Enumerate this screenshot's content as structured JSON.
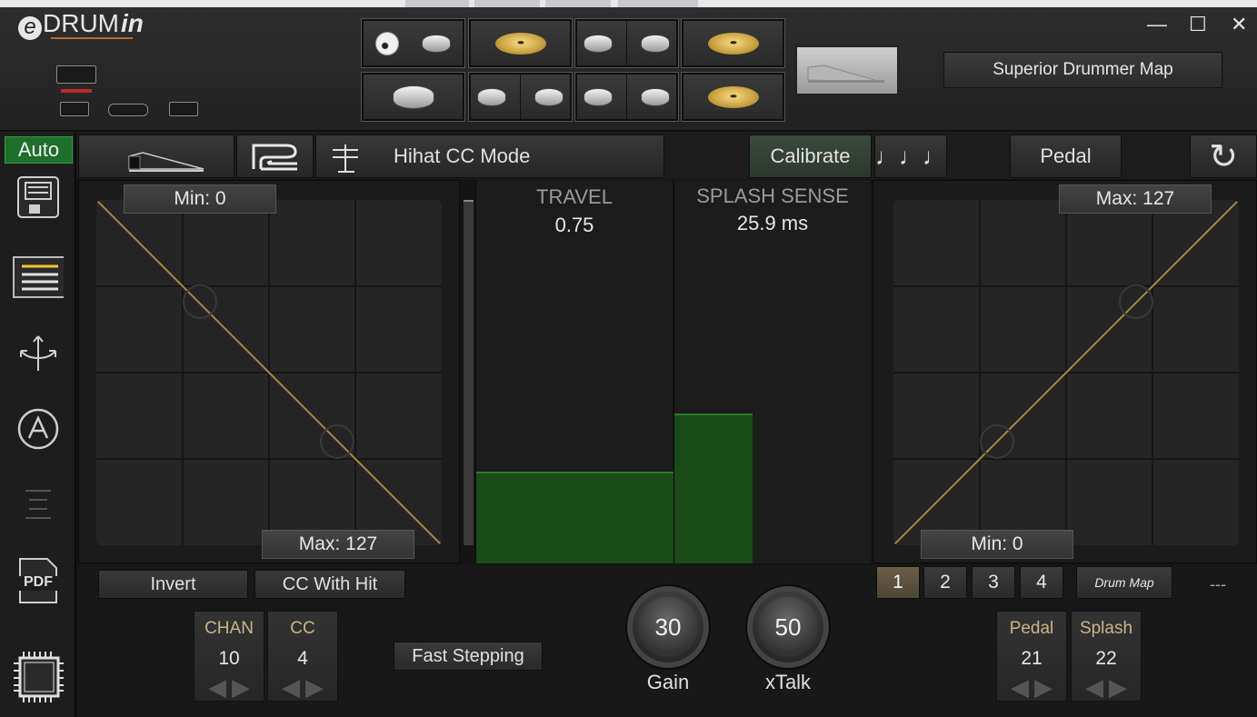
{
  "app": {
    "logo_e": "e",
    "logo_drum": "DRUM",
    "logo_in": "in"
  },
  "header": {
    "map_button": "Superior Drummer Map",
    "min_glyph": "—",
    "max_glyph": "☐",
    "close_glyph": "✕"
  },
  "sidebar": {
    "auto_label": "Auto",
    "pdf_label": "PDF"
  },
  "toolbar": {
    "mode_label": "Hihat CC Mode",
    "calibrate_label": "Calibrate",
    "notes_glyph": "♩♩♩",
    "pedal_label": "Pedal",
    "refresh_glyph": "↻"
  },
  "left_graph": {
    "min_label": "Min: 0",
    "max_label": "Max: 127"
  },
  "right_graph": {
    "max_label": "Max: 127",
    "min_label": "Min: 0"
  },
  "travel": {
    "title": "TRAVEL",
    "value": "0.75",
    "level": 0.24
  },
  "splash": {
    "title": "SPLASH SENSE",
    "value": "25.9 ms",
    "level": 0.39
  },
  "bottom": {
    "invert_label": "Invert",
    "cc_with_hit_label": "CC With Hit",
    "fast_stepping_label": "Fast Stepping",
    "chan": {
      "label": "CHAN",
      "value": "10"
    },
    "cc": {
      "label": "CC",
      "value": "4"
    },
    "gain": {
      "label": "Gain",
      "value": "30"
    },
    "xtalk": {
      "label": "xTalk",
      "value": "50"
    },
    "pedal": {
      "label": "Pedal",
      "value": "21"
    },
    "splash": {
      "label": "Splash",
      "value": "22"
    },
    "numbers": [
      "1",
      "2",
      "3",
      "4"
    ],
    "active_number": "1",
    "drum_map_label": "Drum Map",
    "dashes": "---",
    "arrow_left": "◀",
    "arrow_right": "▶"
  },
  "colors": {
    "curve": "#a88a45",
    "bar_fill": "#1a4a18",
    "auto_green": "#1e6e2c"
  }
}
